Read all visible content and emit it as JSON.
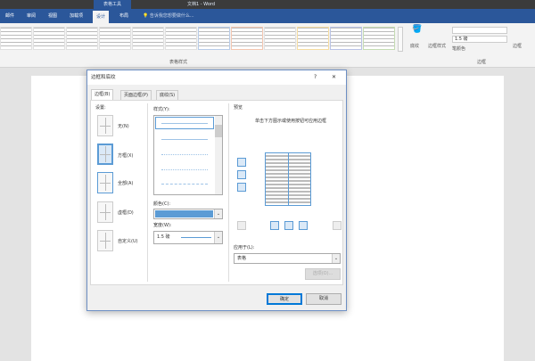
{
  "window": {
    "context_tab": "表格工具",
    "title": "文档1 - Word",
    "tell_me": "告诉我您想要做什么..."
  },
  "ribbon": {
    "tabs": [
      "邮件",
      "审阅",
      "视图",
      "加载项",
      "设计",
      "布局"
    ],
    "active_tab": "设计",
    "groups": {
      "table_styles": "表格样式",
      "borders": "边框"
    },
    "shading_label": "底纹",
    "border_styles_label": "边框样式",
    "pen_width": "1.5 磅",
    "pen_color_label": "笔颜色",
    "borders_label": "边框",
    "border_painter_label": "边框刷"
  },
  "dialog": {
    "title": "边框和底纹",
    "help": "?",
    "close": "✕",
    "tabs": [
      "边框(B)",
      "页面边框(P)",
      "底纹(S)"
    ],
    "setting_label": "设置:",
    "settings": [
      "无(N)",
      "方框(X)",
      "全部(A)",
      "虚框(D)",
      "自定义(U)"
    ],
    "selected_setting": "方框(X)",
    "style_label": "样式(Y):",
    "color_label": "颜色(C):",
    "color_value": "#5b9bd5",
    "width_label": "宽度(W):",
    "width_value": "1.5 磅",
    "preview_label": "预览",
    "preview_hint": "单击下方图示或使用按钮可应用边框",
    "apply_label": "应用于(L):",
    "apply_value": "表格",
    "options": "选项(O)...",
    "ok": "确定",
    "cancel": "取消"
  }
}
